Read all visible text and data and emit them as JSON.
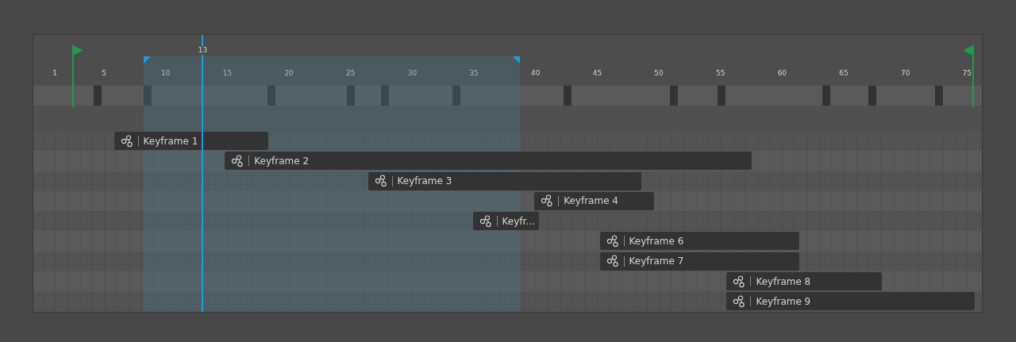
{
  "ruler": {
    "labels": [
      "1",
      "5",
      "10",
      "15",
      "20",
      "25",
      "30",
      "35",
      "40",
      "45",
      "50",
      "55",
      "60",
      "65",
      "70",
      "75"
    ]
  },
  "playhead": {
    "label": "13"
  },
  "keyframes": [
    {
      "label": "Keyframe 1"
    },
    {
      "label": "Keyframe 2"
    },
    {
      "label": "Keyframe 3"
    },
    {
      "label": "Keyframe 4"
    },
    {
      "label": "Keyfr..."
    },
    {
      "label": "Keyframe 6"
    },
    {
      "label": "Keyframe 7"
    },
    {
      "label": "Keyframe 8"
    },
    {
      "label": "Keyframe 9"
    }
  ]
}
